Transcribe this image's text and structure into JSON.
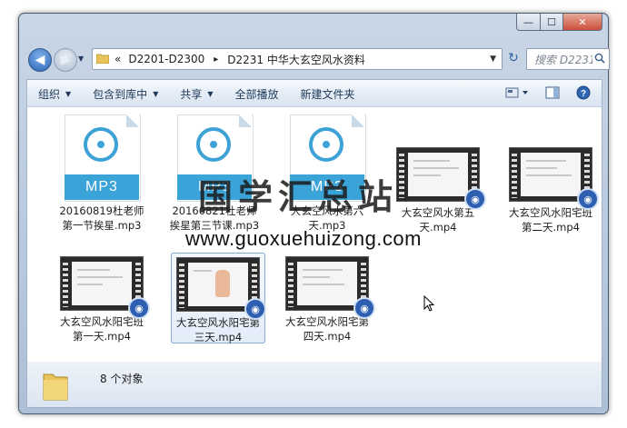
{
  "window": {
    "buttons": {
      "minimize": "—",
      "maximize": "☐",
      "close": "✕"
    }
  },
  "nav": {
    "address": {
      "overflow": "«",
      "crumb1": "D2201-D2300",
      "sep1": "▸",
      "crumb2": "D2231 中华大玄空风水资料"
    },
    "search_placeholder": "搜索 D2231..."
  },
  "toolbar": {
    "organize": "组织",
    "include_in_library": "包含到库中",
    "share": "共享",
    "play_all": "全部播放",
    "new_folder": "新建文件夹"
  },
  "files": [
    {
      "type": "mp3",
      "badge": "MP3",
      "name": "20160819杜老师第一节挨星.mp3"
    },
    {
      "type": "mp3",
      "badge": "MP3",
      "name": "20160821杜老师挨星第三节课.mp3"
    },
    {
      "type": "mp3",
      "badge": "MP3",
      "name": "大玄空风水第六天.mp3"
    },
    {
      "type": "mp4",
      "name": "大玄空风水第五天.mp4"
    },
    {
      "type": "mp4",
      "name": "大玄空风水阳宅班第二天.mp4"
    },
    {
      "type": "mp4",
      "name": "大玄空风水阳宅班第一天.mp4"
    },
    {
      "type": "mp4",
      "name": "大玄空风水阳宅第三天.mp4"
    },
    {
      "type": "mp4",
      "name": "大玄空风水阳宅第四天.mp4"
    }
  ],
  "status": {
    "count_text": "8 个对象"
  },
  "watermark": {
    "text": "国学汇总站",
    "url": "www.guoxuehuizong.com"
  }
}
